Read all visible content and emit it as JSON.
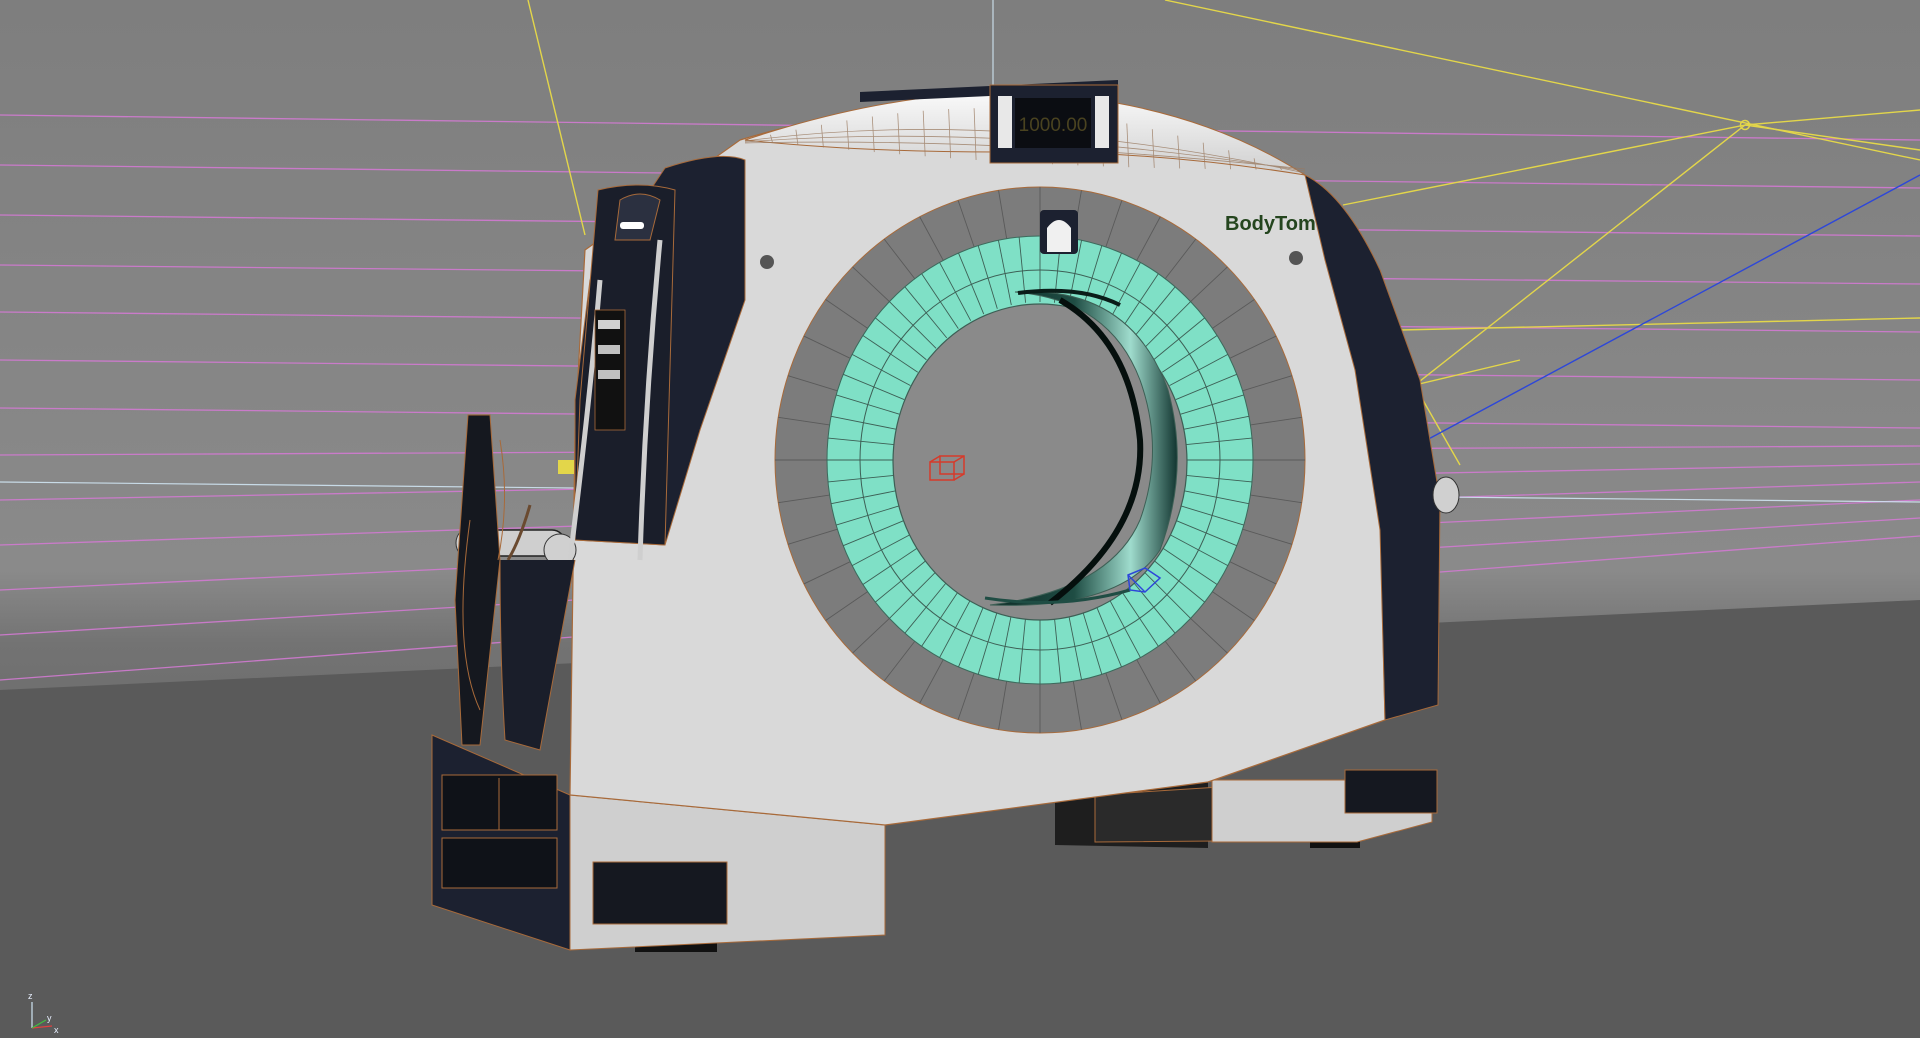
{
  "viewport": {
    "display_value": "1000.00",
    "brand_label": "BodyTom",
    "axis_z_label": "z",
    "axis_y_label": "y",
    "axis_x_label": "x"
  },
  "colors": {
    "background_top": "#7c7c7c",
    "floor": "#585858",
    "grid_line": "#d87ad8",
    "light_line": "#e3d64a",
    "camera_line": "#2d47d9",
    "crosshair": "#cfe4f2",
    "body_shell": "#d8d8d8",
    "dark_panel": "#1c2130",
    "inner_ring": "#7fe0c6",
    "outer_ring": "#7c7c7c",
    "wire_edge": "#a86a3a"
  }
}
